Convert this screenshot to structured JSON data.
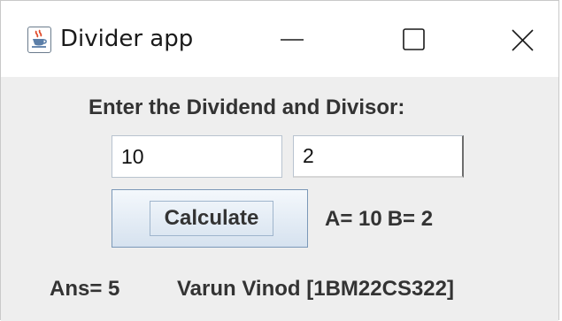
{
  "window": {
    "title": "Divider app",
    "icon": "java-cup-icon",
    "controls": {
      "minimize_icon": "minimize-icon",
      "maximize_icon": "maximize-icon",
      "close_icon": "close-icon"
    }
  },
  "form": {
    "heading": "Enter the Dividend and Divisor:",
    "dividend_value": "10",
    "divisor_value": "2",
    "calculate_label": "Calculate",
    "a_label": "A= 10",
    "b_label": "B= 2",
    "answer_label": "Ans= 5",
    "author_label": "Varun Vinod [1BM22CS322]"
  },
  "colors": {
    "text": "#333333",
    "background": "#eeeeee",
    "button_border": "#7b98b8"
  }
}
